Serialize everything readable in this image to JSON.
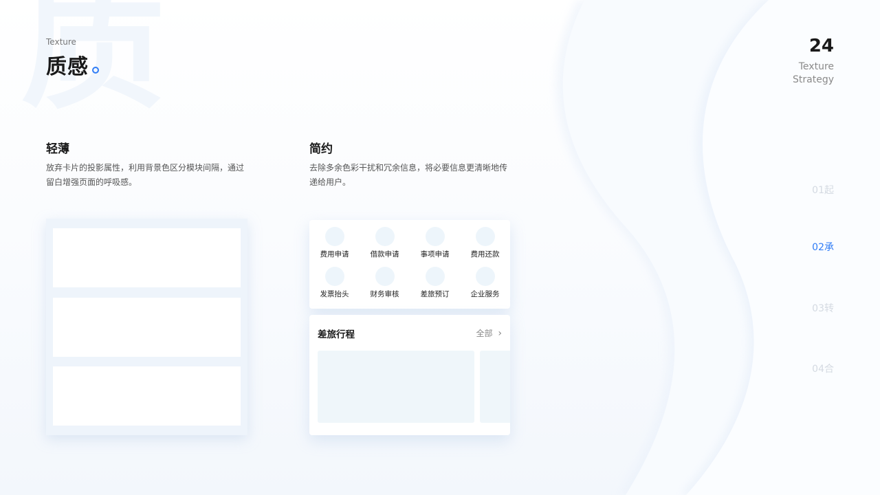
{
  "watermark": "质",
  "header": {
    "subtitle": "Texture",
    "title": "质感"
  },
  "page": {
    "number": "24",
    "label_line1": "Texture",
    "label_line2": "Strategy"
  },
  "section_light": {
    "title": "轻薄",
    "desc_line1": "放弃卡片的投影属性，利用背景色区分模块间隔，通过",
    "desc_line2": "留白增强页面的呼吸感。"
  },
  "section_simple": {
    "title": "简约",
    "desc_line1": "去除多余色彩干扰和冗余信息，将必要信息更清晰地传",
    "desc_line2": "递给用户。"
  },
  "grid_items": [
    "费用申请",
    "借款申请",
    "事项申请",
    "费用还款",
    "发票抬头",
    "财务审核",
    "差旅预订",
    "企业服务"
  ],
  "trip": {
    "title": "差旅行程",
    "all_label": "全部",
    "chevron": "›"
  },
  "nav": [
    "01起",
    "02承",
    "03转",
    "04合"
  ],
  "colors": {
    "accent": "#2f7cf6",
    "nav_inactive": "#d4dae2"
  }
}
